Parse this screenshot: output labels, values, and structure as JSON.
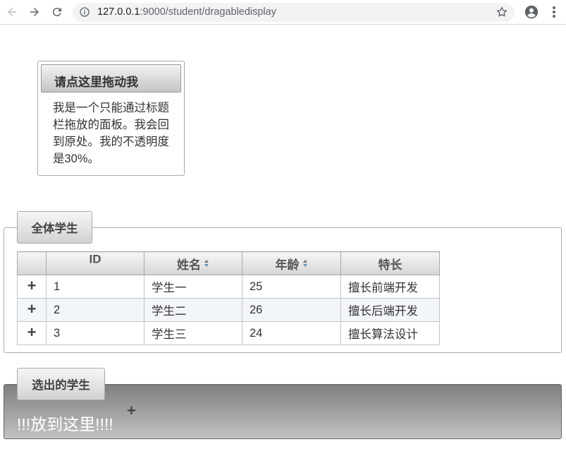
{
  "browser": {
    "url_host": "127.0.0.1",
    "url_rest": ":9000/student/dragabledisplay"
  },
  "drag_panel": {
    "title": "请点这里拖动我",
    "body": "我是一个只能通过标题栏拖放的面板。我会回到原处。我的不透明度是30%。"
  },
  "all_students": {
    "legend": "全体学生",
    "columns": [
      "",
      "ID",
      "姓名",
      "年龄",
      "特长"
    ],
    "rows": [
      {
        "add": "+",
        "id": "1",
        "name": "学生一",
        "age": "25",
        "skill": "擅长前端开发"
      },
      {
        "add": "+",
        "id": "2",
        "name": "学生二",
        "age": "26",
        "skill": "擅长后端开发"
      },
      {
        "add": "+",
        "id": "3",
        "name": "学生三",
        "age": "24",
        "skill": "擅长算法设计"
      }
    ]
  },
  "selected_students": {
    "legend": "选出的学生",
    "drop_text": "!!!放到这里!!!!",
    "plus": "+"
  }
}
